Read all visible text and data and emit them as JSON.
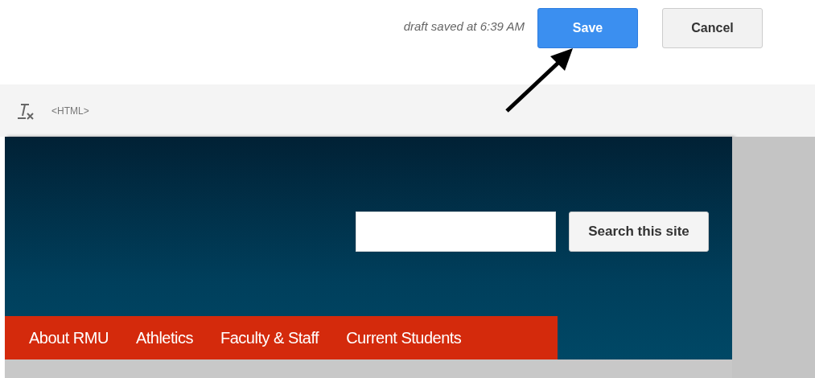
{
  "header": {
    "draft_status": "draft saved at 6:39 AM",
    "buttons": [
      {
        "label": "Save",
        "kind": "primary"
      },
      {
        "label": "Cancel",
        "kind": "secondary"
      }
    ]
  },
  "toolbar": {
    "html_label": "<HTML>"
  },
  "site": {
    "search_button": "Search this site",
    "nav": [
      "About RMU",
      "Athletics",
      "Faculty & Staff",
      "Current Students"
    ]
  }
}
